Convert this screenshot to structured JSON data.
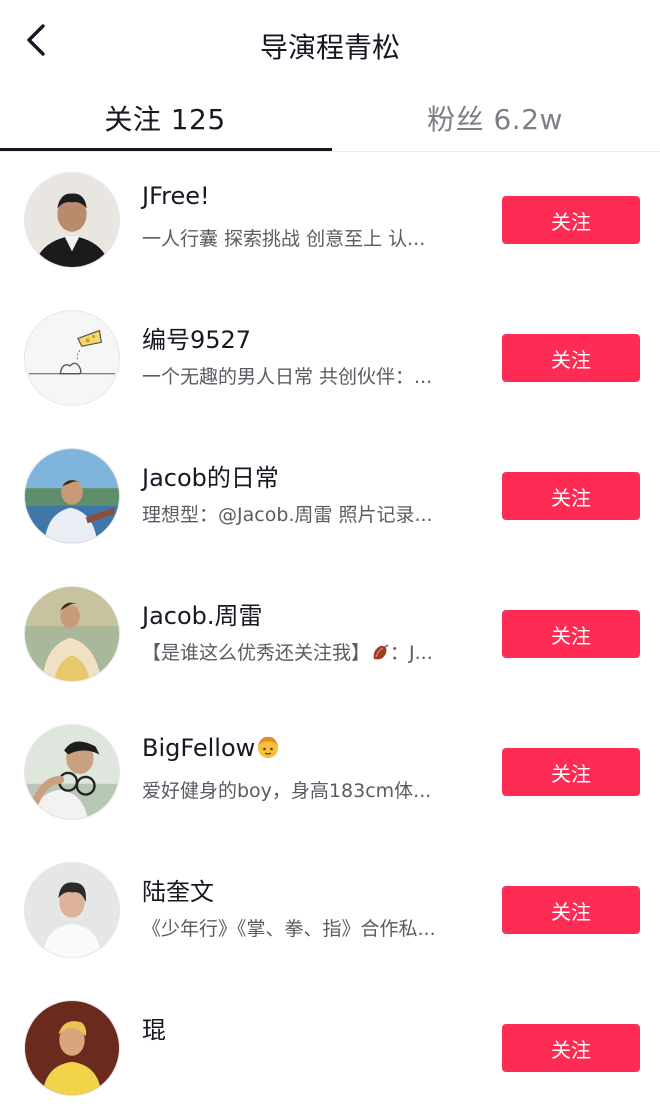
{
  "header": {
    "title": "导演程青松"
  },
  "tabs": [
    {
      "label": "关注 125",
      "active": true
    },
    {
      "label": "粉丝 6.2w",
      "active": false
    }
  ],
  "users": [
    {
      "name": "JFree!",
      "bio": "一人行囊 探索挑战 创意至上 认...",
      "button": "关注"
    },
    {
      "name": "编号9527",
      "bio": "一个无趣的男人日常 共创伙伴：...",
      "button": "关注"
    },
    {
      "name": "Jacob的日常",
      "bio": "理想型：@Jacob.周雷 照片记录...",
      "button": "关注"
    },
    {
      "name": "Jacob.周雷",
      "bio_before": "【是谁这么优秀还关注我】",
      "bio_after": "：J...",
      "button": "关注"
    },
    {
      "name": "BigFellow",
      "bio": "爱好健身的boy，身高183cm体...",
      "button": "关注"
    },
    {
      "name": "陆奎文",
      "bio": "《少年行》《掌、拳、指》合作私...",
      "button": "关注"
    },
    {
      "name": "琨",
      "bio": "",
      "button": "关注"
    }
  ],
  "colors": {
    "accent": "#fe2c55",
    "text_primary": "#161823",
    "text_secondary": "#5a5c63"
  }
}
